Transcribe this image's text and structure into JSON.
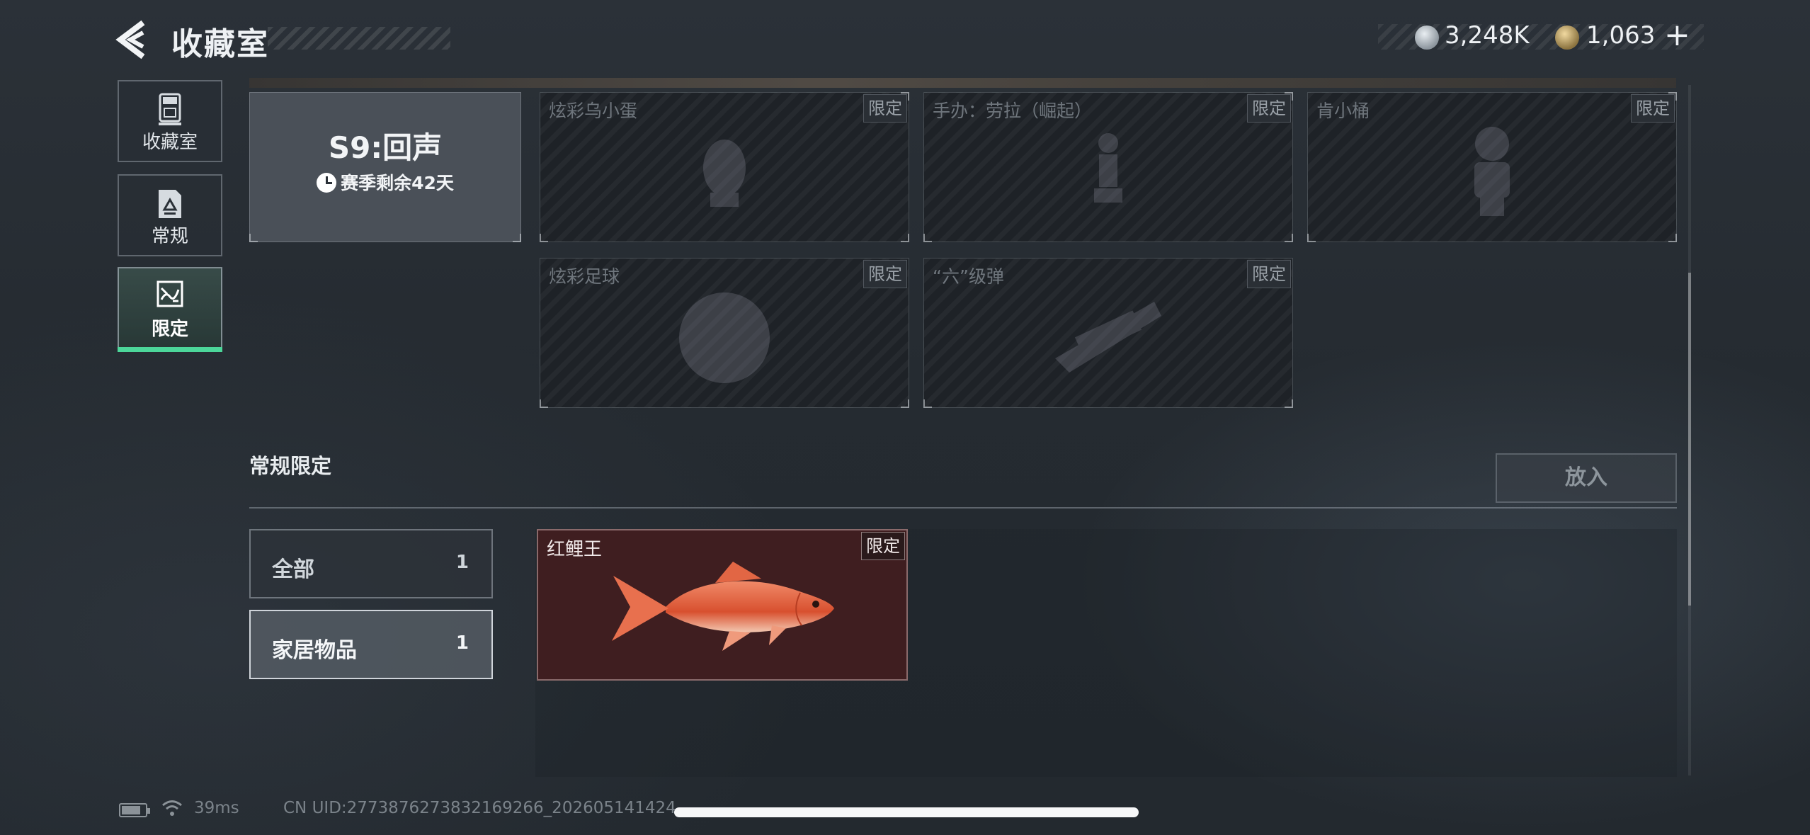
{
  "header": {
    "title": "收藏室",
    "currency": [
      {
        "icon": "silver-coin-icon",
        "value": "3,248K"
      },
      {
        "icon": "gold-coin-icon",
        "value": "1,063"
      }
    ],
    "add_label": "+"
  },
  "nav": [
    {
      "label": "收藏室",
      "icon": "trophy-icon"
    },
    {
      "label": "常规",
      "icon": "document-icon"
    },
    {
      "label": "限定",
      "icon": "limited-map-icon",
      "active": true
    }
  ],
  "season": {
    "title": "S9:回声",
    "remaining": "赛季剩余42天"
  },
  "locked_cards": [
    {
      "name": "炫彩乌小蛋",
      "tag": "限定"
    },
    {
      "name": "手办：劳拉（崛起）",
      "tag": "限定"
    },
    {
      "name": "肯小桶",
      "tag": "限定"
    },
    {
      "name": "炫彩足球",
      "tag": "限定"
    },
    {
      "name": "“六”级弹",
      "tag": "限定"
    }
  ],
  "section": {
    "title": "常规限定",
    "put_button": "放入"
  },
  "filters": [
    {
      "label": "全部",
      "count": "1"
    },
    {
      "label": "家居物品",
      "count": "1",
      "selected": true
    }
  ],
  "items": [
    {
      "name": "红鲤王",
      "tag": "限定",
      "color": "#3f1e20"
    }
  ],
  "footer": {
    "ping": "39ms",
    "uid": "CN UID:2773876273832169266_202605141424"
  },
  "colors": {
    "accent_active": "#4cd79a",
    "background": "#252b31",
    "item_rare": "#3f1e20"
  }
}
